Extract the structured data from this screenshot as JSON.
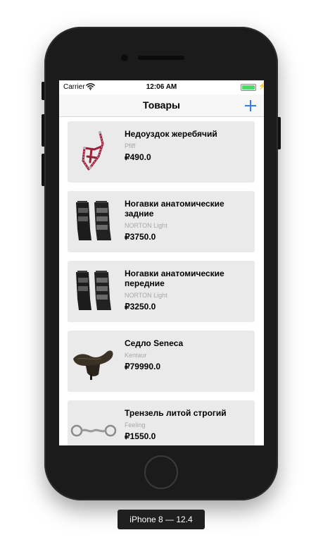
{
  "status_bar": {
    "carrier": "Carrier",
    "time": "12:06 AM"
  },
  "nav": {
    "title": "Товары",
    "add_icon": "plus-icon"
  },
  "products": [
    {
      "name": "Недоуздок жеребячий",
      "brand": "Pfiff",
      "price": "₽490.0",
      "image_icon": "halter-icon"
    },
    {
      "name": "Ногавки анатомические задние",
      "brand": "NORTON Light",
      "price": "₽3750.0",
      "image_icon": "horse-boots-icon"
    },
    {
      "name": "Ногавки анатомические передние",
      "brand": "NORTON Light",
      "price": "₽3250.0",
      "image_icon": "horse-boots-icon"
    },
    {
      "name": "Седло Seneca",
      "brand": "Kentaur",
      "price": "₽79990.0",
      "image_icon": "saddle-icon"
    },
    {
      "name": "Трензель литой строгий",
      "brand": "Feeling",
      "price": "₽1550.0",
      "image_icon": "bit-icon"
    }
  ],
  "device_label": "iPhone 8 — 12.4",
  "colors": {
    "accent": "#2f80ed",
    "card_bg": "#eaeaea",
    "battery": "#4cd964"
  }
}
